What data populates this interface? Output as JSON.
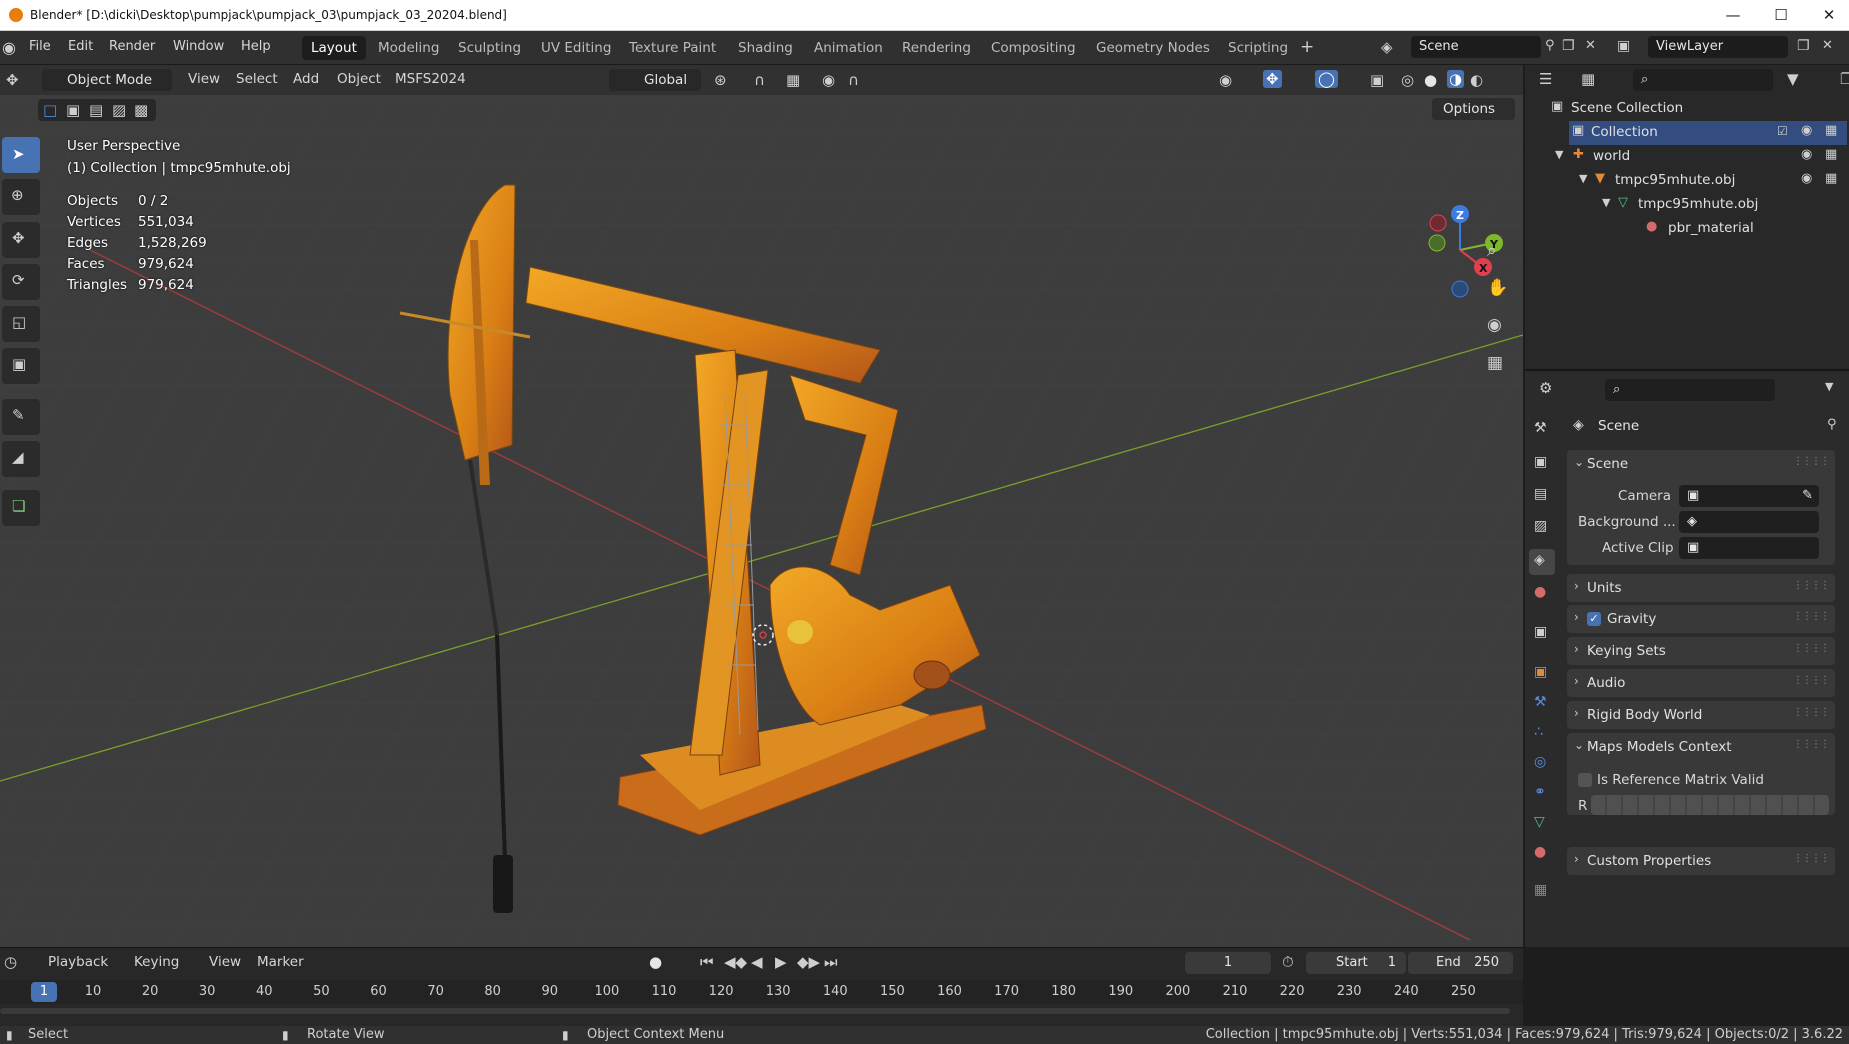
{
  "window": {
    "title": "Blender* [D:\\dicki\\Desktop\\pumpjack\\pumpjack_03\\pumpjack_03_20204.blend]"
  },
  "menu": [
    "File",
    "Edit",
    "Render",
    "Window",
    "Help"
  ],
  "workspaces": [
    "Layout",
    "Modeling",
    "Sculpting",
    "UV Editing",
    "Texture Paint",
    "Shading",
    "Animation",
    "Rendering",
    "Compositing",
    "Geometry Nodes",
    "Scripting"
  ],
  "active_workspace": "Layout",
  "scene_field": "Scene",
  "viewlayer_field": "ViewLayer",
  "viewport": {
    "mode": "Object Mode",
    "menus": [
      "View",
      "Select",
      "Add",
      "Object",
      "MSFS2024"
    ],
    "orientation": "Global",
    "options_label": "Options",
    "overlay_title": "User Perspective",
    "overlay_subtitle": "(1) Collection | tmpc95mhute.obj",
    "stats": [
      {
        "label": "Objects",
        "value": "0 / 2"
      },
      {
        "label": "Vertices",
        "value": "551,034"
      },
      {
        "label": "Edges",
        "value": "1,528,269"
      },
      {
        "label": "Faces",
        "value": "979,624"
      },
      {
        "label": "Triangles",
        "value": "979,624"
      }
    ],
    "gizmo": {
      "z": "Z",
      "y": "Y",
      "x": "X"
    }
  },
  "outliner": {
    "items": [
      {
        "label": "Scene Collection"
      },
      {
        "label": "Collection"
      },
      {
        "label": "world"
      },
      {
        "label": "tmpc95mhute.obj"
      },
      {
        "label": "tmpc95mhute.obj"
      },
      {
        "label": "pbr_material"
      }
    ]
  },
  "properties": {
    "header": "Scene",
    "scene_panel": "Scene",
    "camera_label": "Camera",
    "background_label": "Background ...",
    "active_clip_label": "Active Clip",
    "panels": [
      "Units",
      "Gravity",
      "Keying Sets",
      "Audio",
      "Rigid Body World",
      "Maps Models Context"
    ],
    "is_ref_label": "Is Reference Matrix Valid",
    "r_label": "R",
    "custom_props": "Custom Properties"
  },
  "timeline": {
    "menus": [
      "Playback",
      "Keying",
      "View",
      "Marker"
    ],
    "current_frame": "1",
    "start_label": "Start",
    "start_value": "1",
    "end_label": "End",
    "end_value": "250",
    "ticks": [
      "1",
      "10",
      "20",
      "30",
      "40",
      "50",
      "60",
      "70",
      "80",
      "90",
      "100",
      "110",
      "120",
      "130",
      "140",
      "150",
      "160",
      "170",
      "180",
      "190",
      "200",
      "210",
      "220",
      "230",
      "240",
      "250"
    ]
  },
  "statusbar": {
    "select": "Select",
    "rotate": "Rotate View",
    "context": "Object Context Menu",
    "info": "Collection | tmpc95mhute.obj | Verts:551,034 | Faces:979,624 | Tris:979,624 | Objects:0/2 | 3.6.22"
  }
}
